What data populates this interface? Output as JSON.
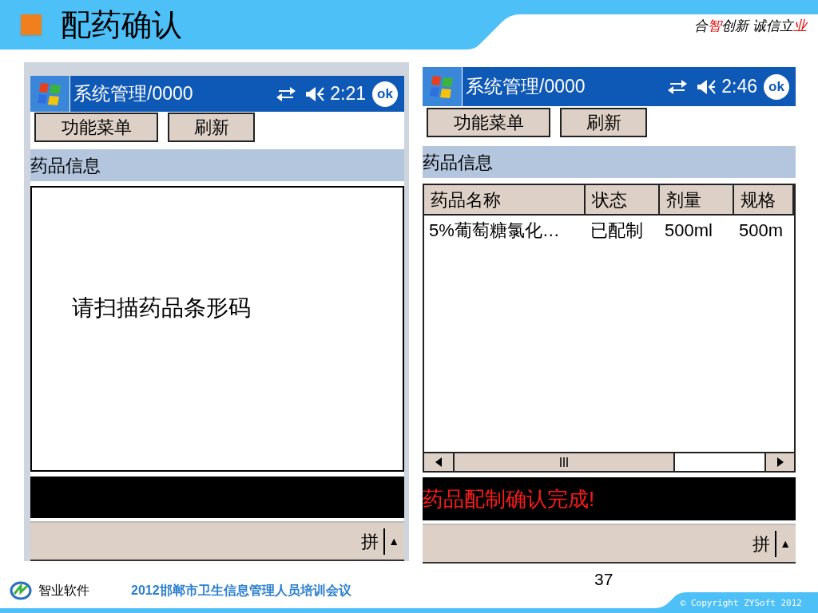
{
  "slide": {
    "title": "配药确认",
    "slogan": [
      {
        "text": "合",
        "accent": false
      },
      {
        "text": "智",
        "accent": true
      },
      {
        "text": "创新 诚信立",
        "accent": false
      },
      {
        "text": "业",
        "accent": true
      }
    ]
  },
  "screens": [
    {
      "kind": "prompt",
      "title": "系统管理/0000",
      "time": "2:21",
      "ok": "ok",
      "buttons": [
        "功能菜单",
        "刷新"
      ],
      "section": "药品信息",
      "prompt": "请扫描药品条形码",
      "ime": "拼",
      "ime_arrow": "▲"
    },
    {
      "kind": "table",
      "title": "系统管理/0000",
      "time": "2:46",
      "ok": "ok",
      "buttons": [
        "功能菜单",
        "刷新"
      ],
      "section": "药品信息",
      "columns": [
        "药品名称",
        "状态",
        "剂量",
        "规格"
      ],
      "rows": [
        [
          "5%葡萄糖氯化…",
          "已配制",
          "500ml",
          "500m"
        ]
      ],
      "message": "药品配制确认完成!",
      "ime": "拼",
      "ime_arrow": "▲"
    }
  ],
  "footer": {
    "company": "智业软件",
    "event": "2012邯郸市卫生信息管理人员培训会议",
    "page": "37",
    "copyright": "© Copyright ZYSoft 2012"
  }
}
